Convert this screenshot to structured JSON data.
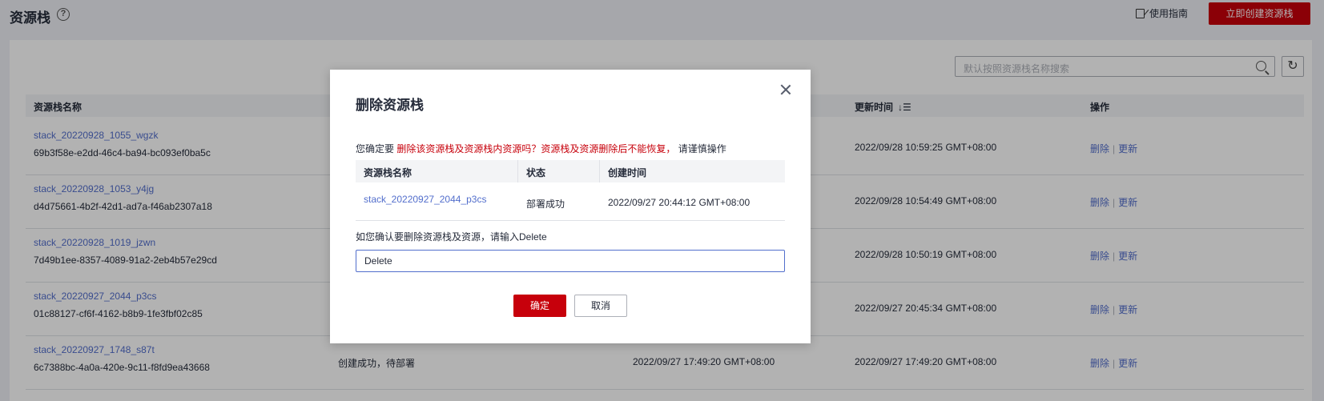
{
  "header": {
    "title": "资源栈",
    "guide_label": "使用指南",
    "create_label": "立即创建资源栈"
  },
  "search": {
    "placeholder": "默认按照资源栈名称搜索"
  },
  "table": {
    "columns": {
      "name": "资源栈名称",
      "updated": "更新时间",
      "ops": "操作"
    },
    "rows": [
      {
        "name": "stack_20220928_1055_wgzk",
        "id": "69b3f58e-e2dd-46c4-ba94-bc093ef0ba5c",
        "status": "",
        "created": "",
        "updated": "2022/09/28 10:59:25 GMT+08:00",
        "delete": "删除",
        "update": "更新"
      },
      {
        "name": "stack_20220928_1053_y4jg",
        "id": "d4d75661-4b2f-42d1-ad7a-f46ab2307a18",
        "status": "",
        "created": "",
        "updated": "2022/09/28 10:54:49 GMT+08:00",
        "delete": "删除",
        "update": "更新"
      },
      {
        "name": "stack_20220928_1019_jzwn",
        "id": "7d49b1ee-8357-4089-91a2-2eb4b57e29cd",
        "status": "",
        "created": "",
        "updated": "2022/09/28 10:50:19 GMT+08:00",
        "delete": "删除",
        "update": "更新"
      },
      {
        "name": "stack_20220927_2044_p3cs",
        "id": "01c88127-cf6f-4162-b8b9-1fe3fbf02c85",
        "status": "",
        "created": "",
        "updated": "2022/09/27 20:45:34 GMT+08:00",
        "delete": "删除",
        "update": "更新"
      },
      {
        "name": "stack_20220927_1748_s87t",
        "id": "6c7388bc-4a0a-420e-9c11-f8fd9ea43668",
        "status": "创建成功，待部署",
        "created": "2022/09/27 17:49:20 GMT+08:00",
        "updated": "2022/09/27 17:49:20 GMT+08:00",
        "delete": "删除",
        "update": "更新"
      }
    ]
  },
  "dialog": {
    "title": "删除资源栈",
    "warn_prefix": "您确定要",
    "warn_danger": "删除该资源栈及资源栈内资源吗？资源栈及资源删除后不能恢复，",
    "warn_suffix": "请谨慎操作",
    "columns": {
      "name": "资源栈名称",
      "status": "状态",
      "created": "创建时间"
    },
    "row": {
      "name": "stack_20220927_2044_p3cs",
      "status": "部署成功",
      "created": "2022/09/27 20:44:12 GMT+08:00"
    },
    "confirm_label": "如您确认要删除资源栈及资源，请输入Delete",
    "confirm_value": "Delete",
    "ok_label": "确定",
    "cancel_label": "取消"
  }
}
